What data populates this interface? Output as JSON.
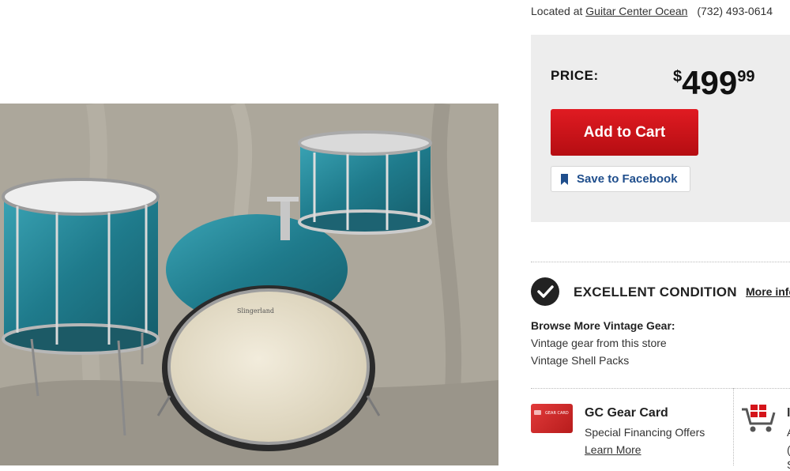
{
  "location": {
    "prefix": "Located at",
    "store": "Guitar Center Ocean",
    "phone": "(732) 493-0614"
  },
  "price": {
    "label": "PRICE:",
    "currency": "$",
    "dollars": "499",
    "cents": "99"
  },
  "buttons": {
    "add_to_cart": "Add to Cart",
    "save_facebook": "Save to Facebook"
  },
  "condition": {
    "label": "EXCELLENT CONDITION",
    "more": "More info"
  },
  "browse": {
    "title": "Browse More Vintage Gear:",
    "links": [
      "Vintage gear from this store",
      "Vintage Shell Packs"
    ]
  },
  "promo": {
    "gear_card": {
      "title": "GC Gear Card",
      "subtitle": "Special Financing Offers",
      "link": "Learn More",
      "card_text": "GEAR CARD"
    },
    "clipped": {
      "title": "I",
      "line1": "A",
      "line2": "(",
      "line3": "S"
    }
  },
  "colors": {
    "accent": "#d4141a",
    "facebook": "#1f4e8c",
    "drum_sparkle": "#2a8a9c"
  },
  "icons": {
    "condition": "checkmark-icon",
    "save": "bookmark-icon",
    "cart": "shopping-cart-icon"
  }
}
